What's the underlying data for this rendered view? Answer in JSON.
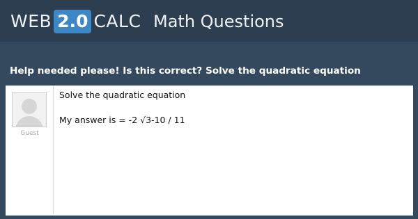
{
  "header": {
    "logo": {
      "web": "WEB",
      "version": "2.0",
      "calc": "CALC"
    },
    "section": "Math Questions"
  },
  "question": {
    "title": "Help needed please! Is this correct? Solve the quadratic equation"
  },
  "post": {
    "author": "Guest",
    "lines": [
      "Solve the quadratic equation",
      "My answer is = -2 √3-10 / 11"
    ]
  },
  "colors": {
    "header_bg": "#2c3e50",
    "page_bg": "#34495e",
    "logo_badge": "#3e87c6"
  }
}
